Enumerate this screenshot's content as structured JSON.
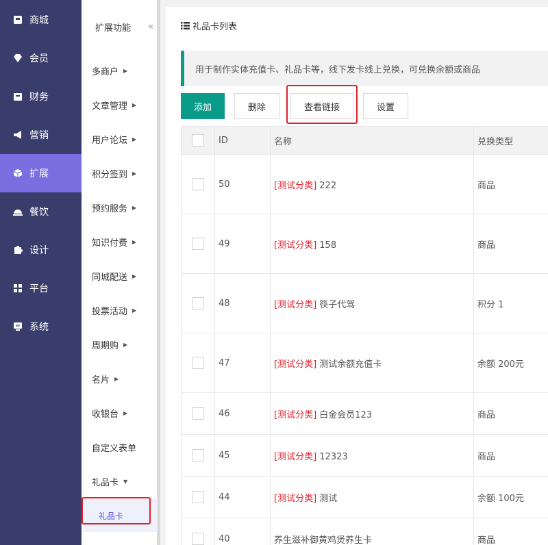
{
  "nav_primary": [
    {
      "label": "商城",
      "icon": "store-icon"
    },
    {
      "label": "会员",
      "icon": "diamond-icon"
    },
    {
      "label": "财务",
      "icon": "wallet-icon"
    },
    {
      "label": "营销",
      "icon": "megaphone-icon"
    },
    {
      "label": "扩展",
      "icon": "cube-icon",
      "active": true
    },
    {
      "label": "餐饮",
      "icon": "dish-icon"
    },
    {
      "label": "设计",
      "icon": "puzzle-icon"
    },
    {
      "label": "平台",
      "icon": "grid-icon"
    },
    {
      "label": "系统",
      "icon": "monitor-icon"
    }
  ],
  "nav_secondary": {
    "header": "扩展功能",
    "collapse_icon": "«",
    "items": [
      {
        "label": "多商户",
        "arrow": "▶"
      },
      {
        "label": "文章管理",
        "arrow": "▶"
      },
      {
        "label": "用户论坛",
        "arrow": "▶"
      },
      {
        "label": "积分签到",
        "arrow": "▶"
      },
      {
        "label": "预约服务",
        "arrow": "▶"
      },
      {
        "label": "知识付费",
        "arrow": "▶"
      },
      {
        "label": "同城配送",
        "arrow": "▶"
      },
      {
        "label": "投票活动",
        "arrow": "▶"
      },
      {
        "label": "周期购",
        "arrow": "▶"
      },
      {
        "label": "名片",
        "arrow": "▶"
      },
      {
        "label": "收银台",
        "arrow": "▶"
      },
      {
        "label": "自定义表单",
        "arrow": ""
      },
      {
        "label": "礼品卡",
        "arrow": "▼"
      }
    ],
    "sub_item": "礼品卡"
  },
  "page": {
    "title": "礼品卡列表",
    "notice": "用于制作实体充值卡、礼品卡等，线下发卡线上兑换，可兑换余额或商品"
  },
  "toolbar": {
    "add": "添加",
    "delete": "删除",
    "view_link": "查看链接",
    "settings": "设置"
  },
  "table": {
    "headers": {
      "id": "ID",
      "name": "名称",
      "type": "兑换类型"
    },
    "rows": [
      {
        "id": "50",
        "category": "[测试分类]",
        "name": " 222",
        "type": "商品"
      },
      {
        "id": "49",
        "category": "[测试分类]",
        "name": " 158",
        "type": "商品"
      },
      {
        "id": "48",
        "category": "[测试分类]",
        "name": " 筷子代驾",
        "type": "积分 1"
      },
      {
        "id": "47",
        "category": "[测试分类]",
        "name": " 测试余额充值卡",
        "type": "余额 200元"
      },
      {
        "id": "46",
        "category": "[测试分类]",
        "name": " 白金会员123",
        "type": "商品"
      },
      {
        "id": "45",
        "category": "[测试分类]",
        "name": " 12323",
        "type": "商品"
      },
      {
        "id": "44",
        "category": "[测试分类]",
        "name": " 测试",
        "type": "余额 100元"
      },
      {
        "id": "40",
        "category": "",
        "name": "养生滋补御黄鸡煲养生卡",
        "type": "商品"
      }
    ]
  },
  "colors": {
    "sidebar_bg": "#393d6b",
    "sidebar_active": "#7a6fe0",
    "accent": "#0a9b89",
    "highlight": "#e0202a"
  }
}
